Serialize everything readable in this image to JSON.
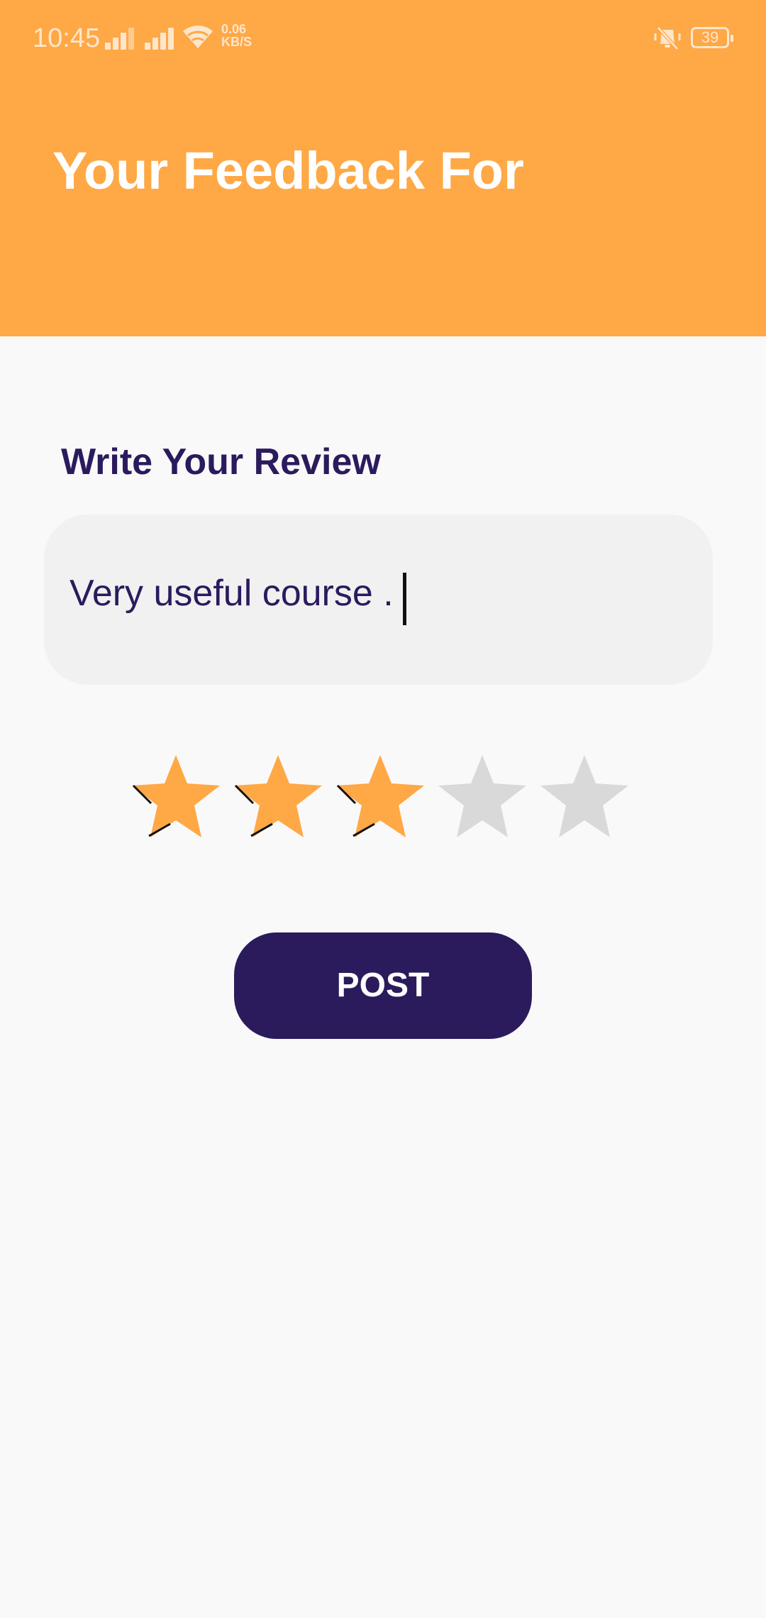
{
  "status_bar": {
    "time": "10:45",
    "network_speed_value": "0.06",
    "network_speed_unit": "KB/S",
    "battery": "39",
    "icons": [
      "signal-icon",
      "signal-icon",
      "wifi-icon",
      "vibrate-off-icon",
      "battery-icon"
    ]
  },
  "header": {
    "title": "Your Feedback For"
  },
  "review": {
    "label": "Write Your Review",
    "value": "Very useful course ."
  },
  "rating": {
    "value": 3,
    "max": 5,
    "filled_color": "#ffa846",
    "empty_color": "#d9d9d9"
  },
  "actions": {
    "post_label": "POST"
  },
  "colors": {
    "header_background": "#ffa846",
    "primary": "#2b1b5d",
    "page_background": "#f9f9f9",
    "input_background": "#f1f1f1"
  }
}
